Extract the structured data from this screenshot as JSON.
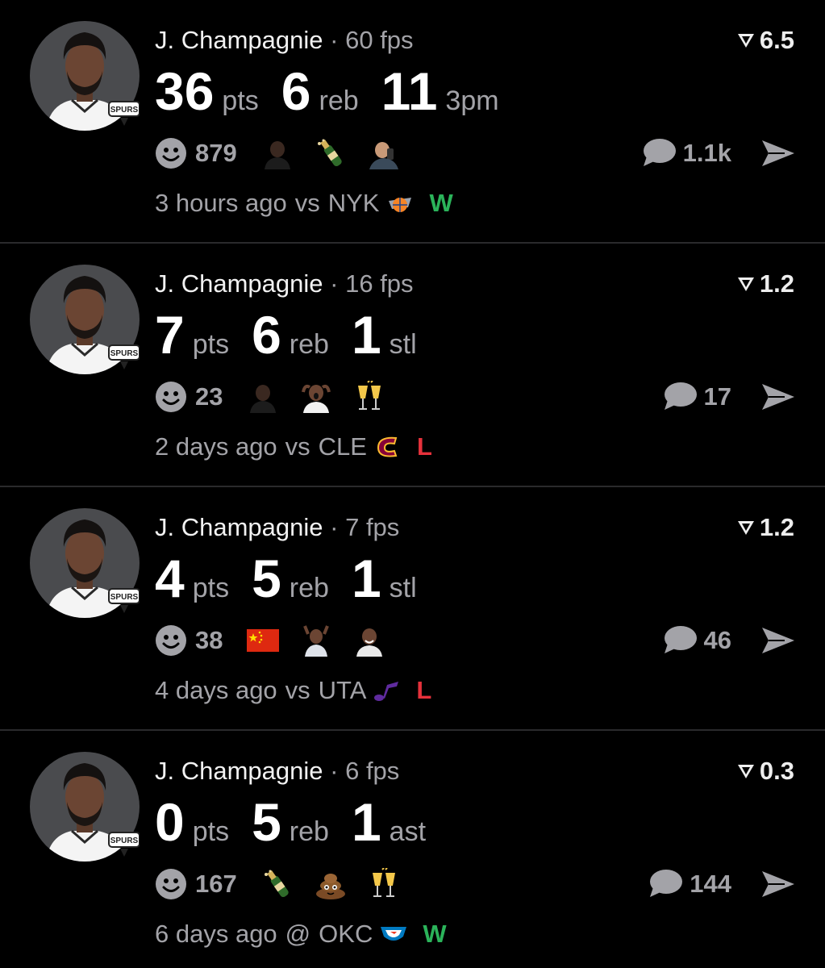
{
  "colors": {
    "win": "#2bb35a",
    "loss": "#e5313b",
    "muted": "#a3a3a8",
    "spurs_jersey": "#ffffff"
  },
  "posts": [
    {
      "player": "J. Champagnie",
      "separator": "·",
      "fps": "60 fps",
      "score": "6.5",
      "stats": [
        {
          "value": "36",
          "unit": "pts"
        },
        {
          "value": "6",
          "unit": "reb"
        },
        {
          "value": "11",
          "unit": "3pm"
        }
      ],
      "reaction_count": "879",
      "reaction_emojis": [
        "person-reaction",
        "champagne-bottle",
        "person-phone-reaction"
      ],
      "comment_count": "1.1k",
      "time_ago": "3 hours ago",
      "matchup_prefix": "vs",
      "opponent": "NYK",
      "opponent_logo": "knicks-logo",
      "result": "W",
      "result_type": "win"
    },
    {
      "player": "J. Champagnie",
      "separator": "·",
      "fps": "16 fps",
      "score": "1.2",
      "stats": [
        {
          "value": "7",
          "unit": "pts"
        },
        {
          "value": "6",
          "unit": "reb"
        },
        {
          "value": "1",
          "unit": "stl"
        }
      ],
      "reaction_count": "23",
      "reaction_emojis": [
        "person-reaction",
        "shocked-person",
        "clinking-glasses"
      ],
      "comment_count": "17",
      "time_ago": "2 days ago",
      "matchup_prefix": "vs",
      "opponent": "CLE",
      "opponent_logo": "cavaliers-logo",
      "result": "L",
      "result_type": "loss"
    },
    {
      "player": "J. Champagnie",
      "separator": "·",
      "fps": "7 fps",
      "score": "1.2",
      "stats": [
        {
          "value": "4",
          "unit": "pts"
        },
        {
          "value": "5",
          "unit": "reb"
        },
        {
          "value": "1",
          "unit": "stl"
        }
      ],
      "reaction_count": "38",
      "reaction_emojis": [
        "china-flag",
        "player-reaction",
        "person-laughing"
      ],
      "comment_count": "46",
      "time_ago": "4 days ago",
      "matchup_prefix": "vs",
      "opponent": "UTA",
      "opponent_logo": "jazz-logo",
      "result": "L",
      "result_type": "loss"
    },
    {
      "player": "J. Champagnie",
      "separator": "·",
      "fps": "6 fps",
      "score": "0.3",
      "stats": [
        {
          "value": "0",
          "unit": "pts"
        },
        {
          "value": "5",
          "unit": "reb"
        },
        {
          "value": "1",
          "unit": "ast"
        }
      ],
      "reaction_count": "167",
      "reaction_emojis": [
        "champagne-bottle",
        "poop",
        "clinking-glasses"
      ],
      "comment_count": "144",
      "time_ago": "6 days ago",
      "matchup_prefix": "@",
      "opponent": "OKC",
      "opponent_logo": "thunder-logo",
      "result": "W",
      "result_type": "win"
    }
  ]
}
